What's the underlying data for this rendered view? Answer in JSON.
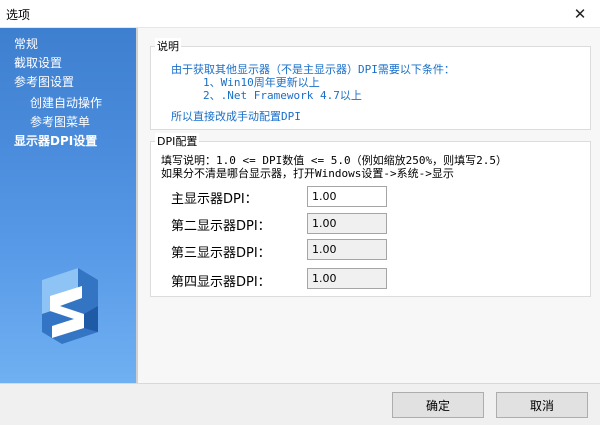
{
  "window": {
    "title": "选项",
    "close_glyph": "✕"
  },
  "sidebar": {
    "items": [
      {
        "label": "常规",
        "level": 0,
        "active": false
      },
      {
        "label": "截取设置",
        "level": 0,
        "active": false
      },
      {
        "label": "参考图设置",
        "level": 0,
        "active": false
      },
      {
        "label": "创建自动操作",
        "level": 1,
        "active": false
      },
      {
        "label": "参考图菜单",
        "level": 1,
        "active": false
      },
      {
        "label": "显示器DPI设置",
        "level": 0,
        "active": true
      }
    ],
    "gradient_top": "#3e7fcf",
    "gradient_bottom": "#6fb0f2"
  },
  "info_section": {
    "legend": "说明",
    "line1": "由于获取其他显示器（不是主显示器）DPI需要以下条件：",
    "line2": "1、Win10周年更新以上",
    "line3": "2、.Net Framework 4.7以上",
    "line4": "所以直接改成手动配置DPI",
    "text_color": "#1a6fc8"
  },
  "dpi_section": {
    "legend": "DPI配置",
    "hint1": "填写说明：1.0 <= DPI数值 <= 5.0（例如缩放250%，则填写2.5）",
    "hint2": "如果分不清是哪台显示器，打开Windows设置->系统->显示",
    "rows": [
      {
        "label": "主显示器DPI：",
        "value": "1.00"
      },
      {
        "label": "第二显示器DPI：",
        "value": "1.00"
      },
      {
        "label": "第三显示器DPI：",
        "value": "1.00"
      },
      {
        "label": "第四显示器DPI：",
        "value": "1.00"
      }
    ]
  },
  "footer": {
    "ok_label": "确定",
    "cancel_label": "取消"
  }
}
